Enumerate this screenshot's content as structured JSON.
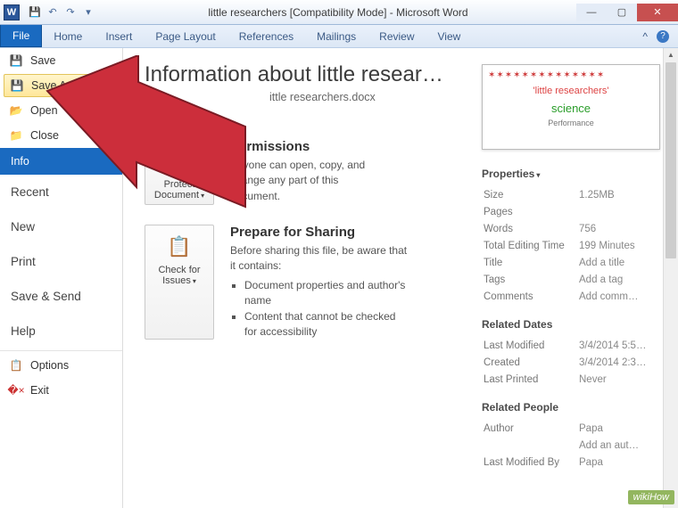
{
  "window": {
    "title": "little researchers [Compatibility Mode] - Microsoft Word"
  },
  "ribbon": {
    "file": "File",
    "tabs": [
      "Home",
      "Insert",
      "Page Layout",
      "References",
      "Mailings",
      "Review",
      "View"
    ]
  },
  "sidebar": {
    "save": "Save",
    "saveas": "Save As",
    "open": "Open",
    "close": "Close",
    "info": "Info",
    "recent": "Recent",
    "new": "New",
    "print": "Print",
    "savesend": "Save & Send",
    "help": "Help",
    "options": "Options",
    "exit": "Exit"
  },
  "main": {
    "heading": "Information about little resear…",
    "path": "ittle researchers.docx",
    "permissions": {
      "btn": "Protect Document",
      "title": "Permissions",
      "text": "Anyone can open, copy, and change any part of this document."
    },
    "prepare": {
      "btn": "Check for Issues",
      "title": "Prepare for Sharing",
      "text": "Before sharing this file, be aware that it contains:",
      "items": [
        "Document properties and author's name",
        "Content that cannot be checked for accessibility"
      ]
    }
  },
  "thumb": {
    "line2": "'little researchers'",
    "line3": "science",
    "line4": "Performance"
  },
  "props": {
    "heading": "Properties",
    "rows": [
      {
        "k": "Size",
        "v": "1.25MB"
      },
      {
        "k": "Pages",
        "v": ""
      },
      {
        "k": "Words",
        "v": "756"
      },
      {
        "k": "Total Editing Time",
        "v": "199 Minutes"
      },
      {
        "k": "Title",
        "v": "Add a title"
      },
      {
        "k": "Tags",
        "v": "Add a tag"
      },
      {
        "k": "Comments",
        "v": "Add comm…"
      }
    ],
    "dates_h": "Related Dates",
    "dates": [
      {
        "k": "Last Modified",
        "v": "3/4/2014 5:5…"
      },
      {
        "k": "Created",
        "v": "3/4/2014 2:3…"
      },
      {
        "k": "Last Printed",
        "v": "Never"
      }
    ],
    "people_h": "Related People",
    "people": [
      {
        "k": "Author",
        "v": "Papa"
      },
      {
        "k": "",
        "v": "Add an aut…"
      },
      {
        "k": "Last Modified By",
        "v": "Papa"
      }
    ]
  },
  "watermark": "wikiHow"
}
